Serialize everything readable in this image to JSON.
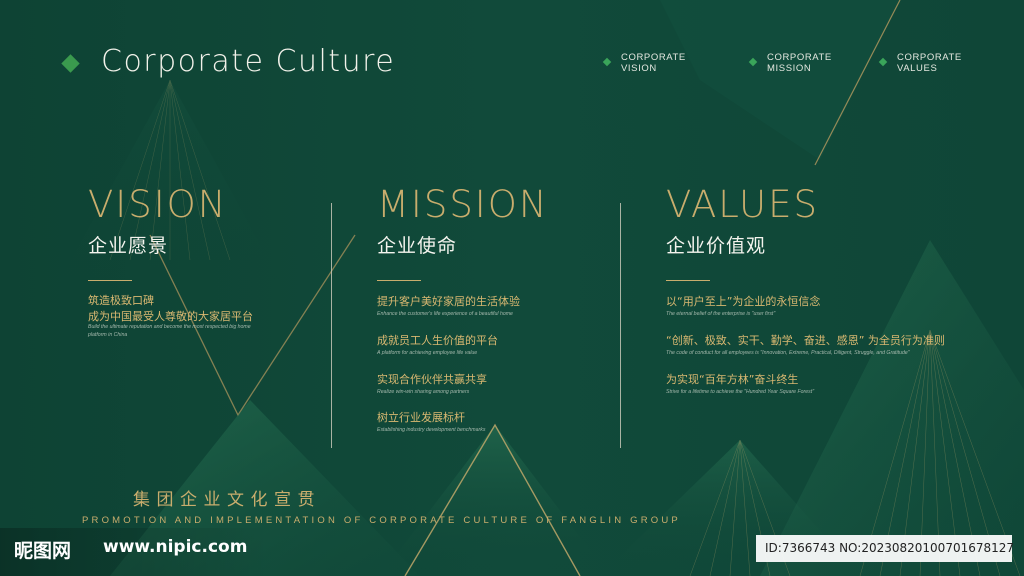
{
  "header": {
    "title": "Corporate Culture",
    "nav": [
      {
        "line1": "CORPORATE",
        "line2": "VISION"
      },
      {
        "line1": "CORPORATE",
        "line2": "MISSION"
      },
      {
        "line1": "CORPORATE",
        "line2": "VALUES"
      }
    ]
  },
  "vision": {
    "heading": "VISION",
    "subtitle": "企业愿景",
    "items": [
      {
        "cn": "筑造极致口碑",
        "en": ""
      },
      {
        "cn": "成为中国最受人尊敬的大家居平台",
        "en": "Build the ultimate reputation and become the most respected big home",
        "en2": "platform in China"
      }
    ]
  },
  "mission": {
    "heading": "MISSION",
    "subtitle": "企业使命",
    "items": [
      {
        "cn": "提升客户美好家居的生活体验",
        "en": "Enhance the customer's life experience of a beautiful home"
      },
      {
        "cn": "成就员工人生价值的平台",
        "en": "A platform for achieving employee life value"
      },
      {
        "cn": "实现合作伙伴共赢共享",
        "en": "Realize win-win sharing among partners"
      },
      {
        "cn": "树立行业发展标杆",
        "en": "Establishing industry development benchmarks"
      }
    ]
  },
  "values": {
    "heading": "VALUES",
    "subtitle": "企业价值观",
    "items": [
      {
        "cn": "以“用户至上”为企业的永恒信念",
        "en": "The eternal belief of the enterprise is \"user first\""
      },
      {
        "cn": "“创新、极致、实干、勤学、奋进、感恩” 为全员行为准则",
        "en": "The code of conduct for all employees is \"Innovation, Extreme, Practical, Diligent, Struggle, and Gratitude\""
      },
      {
        "cn": "为实现“百年方林”奋斗终生",
        "en": "Strive for a lifetime to achieve the \"Hundred Year Square Forest\""
      }
    ]
  },
  "footer": {
    "cn": "集团企业文化宣贯",
    "en": "PROMOTION AND IMPLEMENTATION OF CORPORATE CULTURE OF FANGLIN GROUP"
  },
  "watermark": {
    "logo": "昵图网",
    "url": "www.nipic.com",
    "id": "ID:7366743 NO:20230820100701678127"
  },
  "colors": {
    "background": "#0f4536",
    "gold": "#c9ad6d",
    "accent_green": "#3a9a4e"
  }
}
